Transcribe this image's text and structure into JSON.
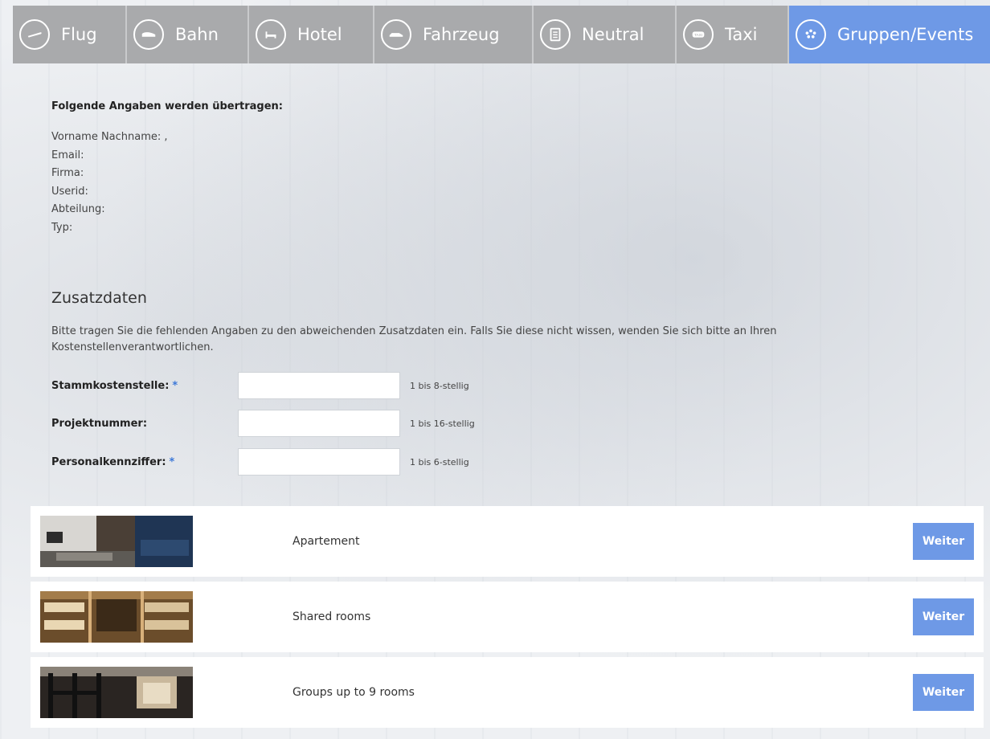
{
  "nav": {
    "tabs": [
      {
        "label": "Flug",
        "icon": "plane-icon"
      },
      {
        "label": "Bahn",
        "icon": "train-icon"
      },
      {
        "label": "Hotel",
        "icon": "bed-icon"
      },
      {
        "label": "Fahrzeug",
        "icon": "car-icon"
      },
      {
        "label": "Neutral",
        "icon": "clipboard-icon"
      },
      {
        "label": "Taxi",
        "icon": "taxi-icon"
      },
      {
        "label": "Gruppen/Events",
        "icon": "group-icon",
        "active": true
      }
    ],
    "colors": {
      "inactive": "#a9aaac",
      "active": "#6e99e6"
    }
  },
  "transfer": {
    "title": "Folgende Angaben werden übertragen:",
    "fields": [
      "Vorname Nachname: ,",
      "Email:",
      "Firma:",
      "Userid:",
      "Abteilung:",
      "Typ:"
    ]
  },
  "zusatz": {
    "title": "Zusatzdaten",
    "description": "Bitte tragen Sie die fehlenden Angaben zu den abweichenden Zusatzdaten ein. Falls Sie diese nicht wissen, wenden Sie sich bitte an Ihren Kostenstellenverantwortlichen.",
    "fields": [
      {
        "label": "Stammkostenstelle:",
        "required": "*",
        "value": "",
        "hint": "1 bis 8-stellig"
      },
      {
        "label": "Projektnummer:",
        "required": "",
        "value": "",
        "hint": "1 bis 16-stellig"
      },
      {
        "label": "Personalkennziffer:",
        "required": "*",
        "value": "",
        "hint": "1 bis 6-stellig"
      }
    ]
  },
  "accommodations": [
    {
      "label": "Apartement",
      "button": "Weiter"
    },
    {
      "label": "Shared rooms",
      "button": "Weiter"
    },
    {
      "label": "Groups up to 9 rooms",
      "button": "Weiter"
    }
  ],
  "accent_color": "#6e99e6"
}
